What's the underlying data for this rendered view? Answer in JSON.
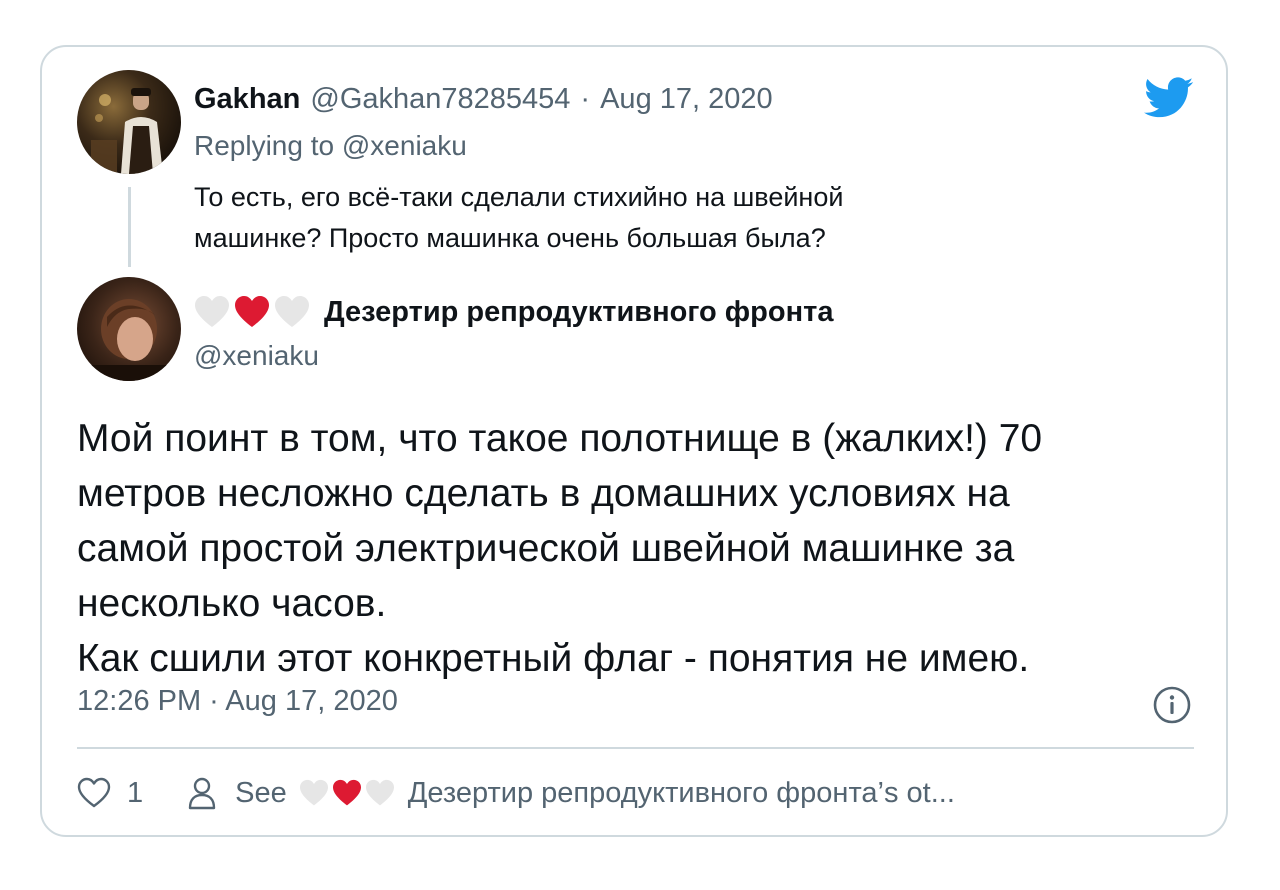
{
  "reply": {
    "name": "Gakhan",
    "handle": "@Gakhan78285454",
    "separator": "·",
    "date": "Aug 17, 2020",
    "replying_prefix": "Replying to",
    "replying_to": "@xeniaku",
    "text_line1": "То есть, его всё-таки сделали стихийно на швейной",
    "text_line2": "машинке? Просто машинка очень большая была?"
  },
  "main": {
    "hearts": [
      "white",
      "red",
      "white"
    ],
    "name": "Дезертир репродуктивного фронта",
    "handle": "@xeniaku",
    "body_lines": [
      "Мой поинт в том, что такое полотнище в (жалких!) 70",
      "метров несложно сделать в домашних условиях на",
      "самой простой электрической швейной машинке за",
      "несколько часов.",
      "Как сшили этот конкретный флаг - понятия не имею."
    ],
    "timestamp": "12:26 PM · Aug 17, 2020"
  },
  "footer": {
    "like_count": "1",
    "see_label": "See",
    "profile_label": "Дезертир репродуктивного фронта’s ot..."
  },
  "colors": {
    "twitter_blue": "#1d9bf0",
    "heart_red": "#e0245e",
    "heart_white": "#e6e6e6",
    "muted_text": "#536471",
    "border": "#cfd9de"
  }
}
